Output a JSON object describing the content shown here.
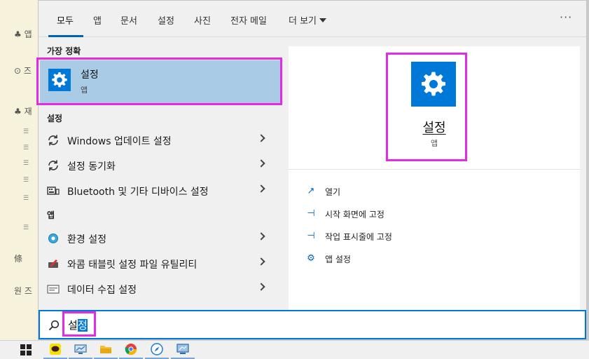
{
  "tabs": [
    "모두",
    "앱",
    "문서",
    "설정",
    "사진",
    "전자 메일",
    "더 보기"
  ],
  "more_options": "···",
  "best_match": {
    "header": "가장 정확",
    "title": "설정",
    "subtitle": "앱"
  },
  "settings_section": {
    "header": "설정",
    "items": [
      "Windows 업데이트 설정",
      "설정 동기화",
      "Bluetooth 및 기타 디바이스 설정"
    ]
  },
  "apps_section": {
    "header": "앱",
    "items": [
      "환경 설정",
      "와콤 태블릿 설정 파일 유틸리티",
      "데이터 수집 설정"
    ]
  },
  "preview": {
    "title": "설정",
    "subtitle": "앱",
    "actions": [
      "열기",
      "시작 화면에 고정",
      "작업 표시줄에 고정",
      "앱 설정"
    ]
  },
  "search": {
    "typed": "설",
    "selected": "정"
  },
  "background_doc": [
    "♣ 앱",
    "⊙ 즈",
    "♣ 재",
    "條 ",
    "원 즈"
  ],
  "taskbar_apps": [
    "kakaotalk-icon",
    "monitor-icon",
    "file-explorer-icon",
    "chrome-icon",
    "safari-icon",
    "remote-desktop-icon"
  ],
  "colors": {
    "accent": "#0078d7",
    "highlight": "#e22be2",
    "selected_row": "#a9cbe6"
  }
}
